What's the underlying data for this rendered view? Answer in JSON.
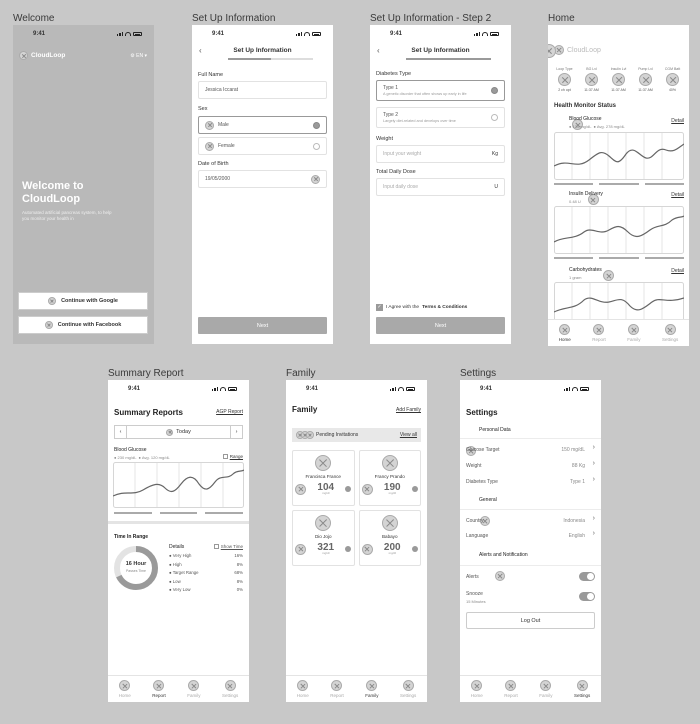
{
  "screens": {
    "welcome": {
      "label": "Welcome",
      "time": "9:41",
      "brand": "CloudLoop",
      "lang": "EN",
      "headline_1": "Welcome to",
      "headline_2": "CloudLoop",
      "desc_1": "Automated artificial pancreas system, to help",
      "desc_2": "you monitor your health in",
      "btn_google": "Continue with Google",
      "btn_facebook": "Continue with Facebook"
    },
    "setup1": {
      "label": "Set Up Information",
      "time": "9:41",
      "title": "Set Up Information",
      "full_name_label": "Full Name",
      "full_name_value": "Jessica Iccarat",
      "sex_label": "Sex",
      "male": "Male",
      "female": "Female",
      "dob_label": "Date of Birth",
      "dob_value": "19/05/2000",
      "next": "Next"
    },
    "setup2": {
      "label": "Set Up Information - Step 2",
      "time": "9:41",
      "title": "Set Up Information",
      "diabetes_label": "Diabetes Type",
      "type1": "Type 1",
      "type1_desc": "A genetic disorder that often shows up early in life",
      "type2": "Type 2",
      "type2_desc": "Largely diet-related and develops over time",
      "weight_label": "Weight",
      "weight_ph": "Input your weight",
      "weight_unit": "Kg",
      "tdd_label": "Total Daily Dose",
      "tdd_ph": "Input daily dose",
      "tdd_unit": "U",
      "agree_1": "I Agree with the",
      "agree_2": "Terms & Conditions",
      "next": "Next"
    },
    "home": {
      "label": "Home",
      "time": "9:41",
      "brand": "CloudLoop",
      "stats": [
        {
          "label": "Loop Type",
          "value": "2 ch opt"
        },
        {
          "label": "BG Lvl",
          "value": "11:37 AM"
        },
        {
          "label": "Insulin Lvl",
          "value": "11:37 AM"
        },
        {
          "label": "Pump Lvl",
          "value": "11:37 AM"
        },
        {
          "label": "CGM Batt",
          "value": "40%"
        }
      ],
      "section": "Health Monitor Status",
      "bg_title": "Blood Glucose",
      "bg_sub_1": "120 mg/dL",
      "bg_sub_2": "Avg. 278 mg/dL",
      "detail": "Detail",
      "ins_title": "Insulin Delivery",
      "ins_sub": "0.48 U",
      "carb_title": "Carbohydrates",
      "carb_sub": "1 gram",
      "nav": [
        "Home",
        "Report",
        "Family",
        "Settings"
      ]
    },
    "summary": {
      "label": "Summary Report",
      "time": "9:41",
      "title": "Summary Reports",
      "agp": "AGP Report",
      "today": "Today",
      "bg_title": "Blood Glucose",
      "bg_sub_1": "230 mg/dL",
      "bg_sub_2": "Avg. 120 mg/dL",
      "range": "Range",
      "tir_title": "Time In Range",
      "donut_main": "16 Hour",
      "donut_sub": "Passes Time",
      "details": "Details",
      "show_time": "Show Time",
      "rows": [
        {
          "name": "Very High",
          "val": "16%"
        },
        {
          "name": "High",
          "val": "8%"
        },
        {
          "name": "Target Range",
          "val": "68%"
        },
        {
          "name": "Low",
          "val": "8%"
        },
        {
          "name": "Very Low",
          "val": "0%"
        }
      ],
      "nav": [
        "Home",
        "Report",
        "Family",
        "Settings"
      ]
    },
    "family": {
      "label": "Family",
      "time": "9:41",
      "title": "Family",
      "add": "Add Family",
      "pending": "Pending Invitations",
      "view_all": "View all",
      "unit": "mg/dl",
      "members": [
        {
          "name": "Francisca France",
          "value": "104"
        },
        {
          "name": "Francy Prando",
          "value": "190"
        },
        {
          "name": "Dio Jojo",
          "value": "321"
        },
        {
          "name": "Babayo",
          "value": "200"
        }
      ],
      "nav": [
        "Home",
        "Report",
        "Family",
        "Settings"
      ]
    },
    "settings": {
      "label": "Settings",
      "time": "9:41",
      "title": "Settings",
      "personal": "Personal Data",
      "glucose_target": "Glucose Target",
      "glucose_target_val": "150 mg/dL",
      "weight": "Weight",
      "weight_val": "88 Kg",
      "diabetes_type": "Diabetes Type",
      "diabetes_type_val": "Type 1",
      "general": "General",
      "country": "Country",
      "country_val": "Indonesia",
      "language": "Language",
      "language_val": "English",
      "alerts_section": "Alerts and Notification",
      "alerts": "Alerts",
      "snooze": "Snooze",
      "snooze_sub": "15 Minutes",
      "logout": "Log Out",
      "nav": [
        "Home",
        "Report",
        "Family",
        "Settings"
      ]
    }
  },
  "colors": {
    "background": "#c8c8c8",
    "placeholder": "#d4d4d4",
    "accent_grey": "#9a9a9a"
  }
}
